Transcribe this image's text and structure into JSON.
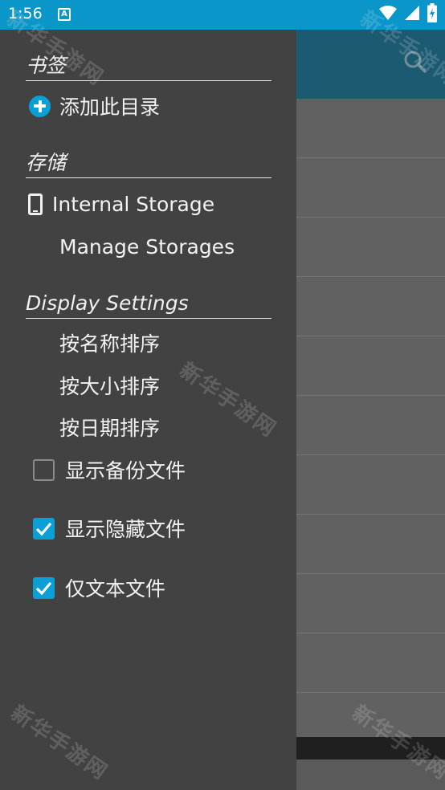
{
  "status_bar": {
    "time": "1:56",
    "notification_icon": "a-box-icon",
    "icons": [
      "wifi-icon",
      "signal-icon",
      "battery-charging-icon"
    ],
    "color": "#0a96c8"
  },
  "drawer": {
    "sections": {
      "bookmarks": {
        "header": "书签",
        "add_label": "添加此目录"
      },
      "storage": {
        "header": "存储",
        "internal_label": "Internal Storage",
        "manage_label": "Manage Storages"
      },
      "display": {
        "header": "Display Settings",
        "sort_name": "按名称排序",
        "sort_size": "按大小排序",
        "sort_date": "按日期排序",
        "show_backup": {
          "label": "显示备份文件",
          "checked": false
        },
        "show_hidden": {
          "label": "显示隐藏文件",
          "checked": true
        },
        "text_only": {
          "label": "仅文本文件",
          "checked": true
        }
      }
    },
    "accent": "#0aa0d6"
  },
  "background_app": {
    "toolbar_color": "#1c5a72",
    "search_icon": "search-icon"
  },
  "watermark": "新华手游网"
}
